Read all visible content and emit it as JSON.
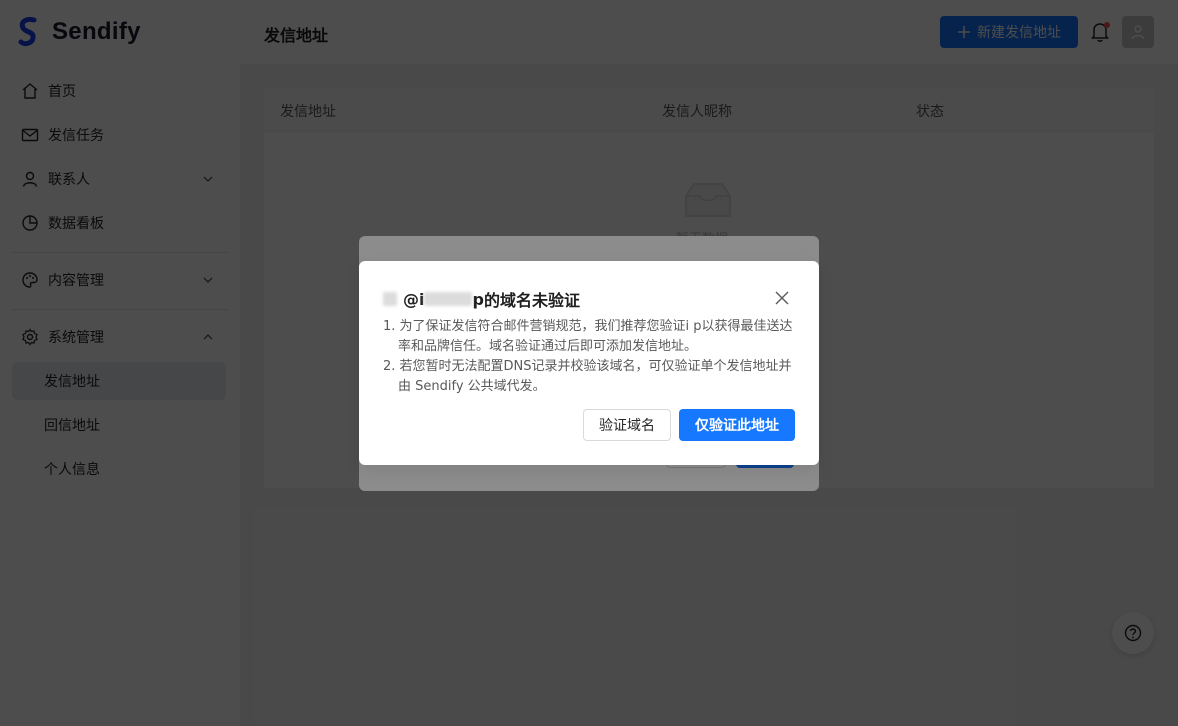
{
  "app": {
    "name": "Sendify"
  },
  "sidebar": {
    "items": [
      {
        "label": "首页",
        "icon": "home-icon"
      },
      {
        "label": "发信任务",
        "icon": "mail-icon"
      },
      {
        "label": "联系人",
        "icon": "user-icon"
      },
      {
        "label": "数据看板",
        "icon": "pie-chart-icon"
      },
      {
        "label": "内容管理",
        "icon": "palette-icon"
      },
      {
        "label": "系统管理",
        "icon": "gear-icon"
      }
    ],
    "sub_items": [
      {
        "label": "发信地址",
        "active": true
      },
      {
        "label": "回信地址",
        "active": false
      },
      {
        "label": "个人信息",
        "active": false
      }
    ]
  },
  "header": {
    "title": "发信地址",
    "new_button_label": "新建发信地址"
  },
  "table": {
    "columns": [
      "发信地址",
      "发信人昵称",
      "状态"
    ],
    "empty_text": "暂无数据"
  },
  "dialog": {
    "title_prefix": "@i",
    "title_mid": "p",
    "title_suffix": "的域名未验证",
    "body": [
      "1. 为了保证发信符合邮件营销规范，我们推荐您验证i        p以获得最佳送达率和品牌信任。域名验证通过后即可添加发信地址。",
      "2. 若您暂时无法配置DNS记录并校验该域名，可仅验证单个发信地址并由 Sendify 公共域代发。"
    ],
    "secondary_button": "验证域名",
    "primary_button": "仅验证此地址"
  },
  "colors": {
    "primary": "#1677ff",
    "notify": "#ff4d4f"
  }
}
